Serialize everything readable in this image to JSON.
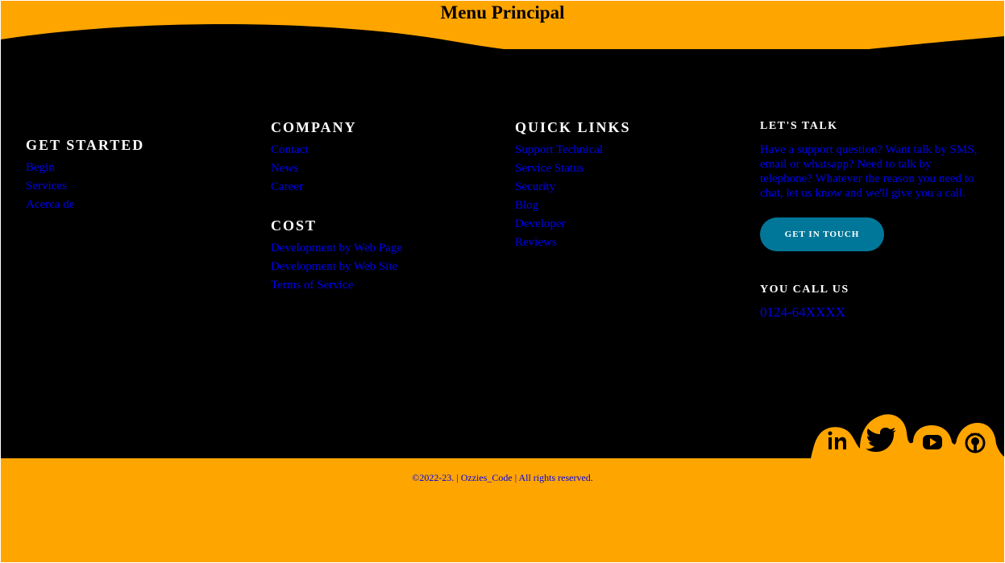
{
  "header": {
    "title": "Menu Principal"
  },
  "footer": {
    "get_started": {
      "title": "GET STARTED",
      "links": [
        "Begin",
        "Services",
        "Acerca de"
      ]
    },
    "company": {
      "title": "COMPANY",
      "links": [
        "Contact",
        "News",
        "Career"
      ]
    },
    "cost": {
      "title": "COST",
      "links": [
        "Development by Web Page",
        "Development by Web Site",
        "Terms of Service"
      ]
    },
    "quick_links": {
      "title": "QUICK LINKS",
      "links": [
        "Support Technical",
        "Service Status",
        "Security",
        "Blog",
        "Developer",
        "Reviews"
      ]
    },
    "lets_talk": {
      "title": "LET'S TALK",
      "text": "Have a support question? Want talk by SMS, email or whatsapp? Need to talk by telephone? Whatever the reason you need to chat, let us know and we'll give you a call.",
      "button": "GET IN TOUCH"
    },
    "call_us": {
      "title": "YOU CALL US",
      "phone": "0124-64XXXX"
    },
    "social": [
      "linkedin-icon",
      "twitter-icon",
      "youtube-icon",
      "github-icon"
    ],
    "copyright": {
      "prefix": "©2022-23. | ",
      "brand": "Ozzies_Code",
      "suffix": " | All rights reserved."
    }
  },
  "colors": {
    "accent": "#ffa500",
    "footer_bg": "#000000",
    "button": "#007799",
    "link": "#0000ee"
  }
}
